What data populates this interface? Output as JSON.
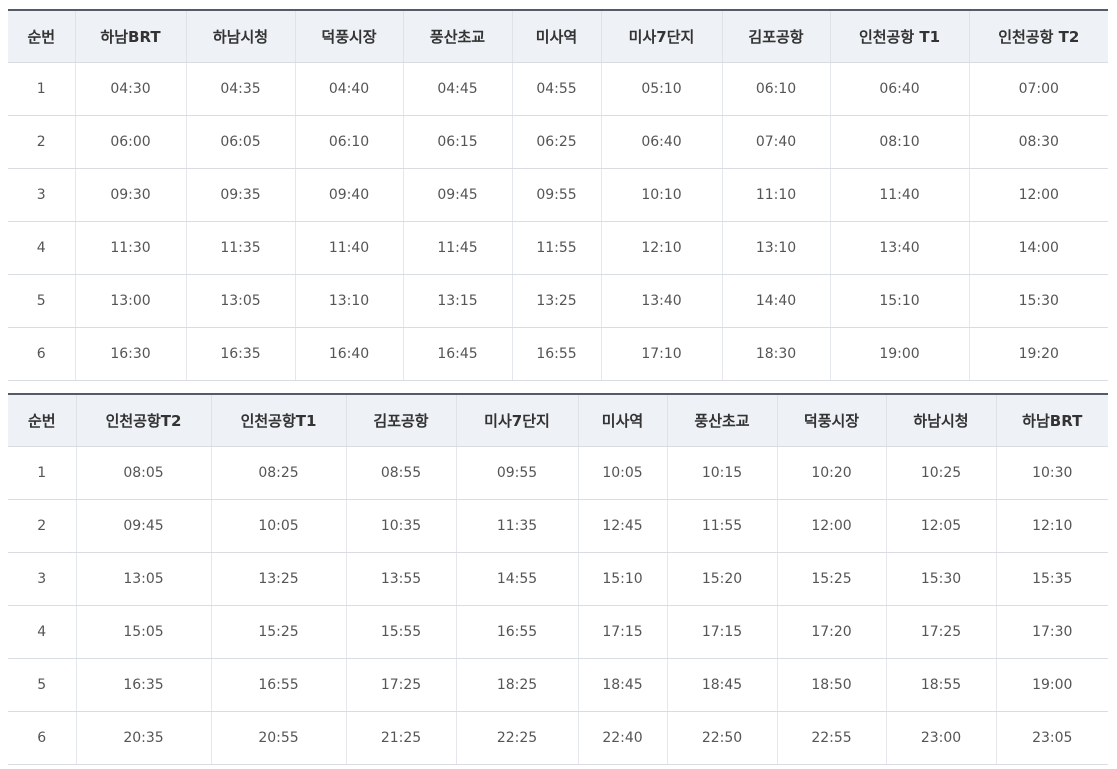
{
  "outbound": {
    "headers": [
      "순번",
      "하남BRT",
      "하남시청",
      "덕풍시장",
      "풍산초교",
      "미사역",
      "미사7단지",
      "김포공항",
      "인천공항 T1",
      "인천공항 T2"
    ],
    "rows": [
      [
        "1",
        "04:30",
        "04:35",
        "04:40",
        "04:45",
        "04:55",
        "05:10",
        "06:10",
        "06:40",
        "07:00"
      ],
      [
        "2",
        "06:00",
        "06:05",
        "06:10",
        "06:15",
        "06:25",
        "06:40",
        "07:40",
        "08:10",
        "08:30"
      ],
      [
        "3",
        "09:30",
        "09:35",
        "09:40",
        "09:45",
        "09:55",
        "10:10",
        "11:10",
        "11:40",
        "12:00"
      ],
      [
        "4",
        "11:30",
        "11:35",
        "11:40",
        "11:45",
        "11:55",
        "12:10",
        "13:10",
        "13:40",
        "14:00"
      ],
      [
        "5",
        "13:00",
        "13:05",
        "13:10",
        "13:15",
        "13:25",
        "13:40",
        "14:40",
        "15:10",
        "15:30"
      ],
      [
        "6",
        "16:30",
        "16:35",
        "16:40",
        "16:45",
        "16:55",
        "17:10",
        "18:30",
        "19:00",
        "19:20"
      ]
    ]
  },
  "inbound": {
    "headers": [
      "순번",
      "인천공항T2",
      "인천공항T1",
      "김포공항",
      "미사7단지",
      "미사역",
      "풍산초교",
      "덕풍시장",
      "하남시청",
      "하남BRT"
    ],
    "rows": [
      [
        "1",
        "08:05",
        "08:25",
        "08:55",
        "09:55",
        "10:05",
        "10:15",
        "10:20",
        "10:25",
        "10:30"
      ],
      [
        "2",
        "09:45",
        "10:05",
        "10:35",
        "11:35",
        "12:45",
        "11:55",
        "12:00",
        "12:05",
        "12:10"
      ],
      [
        "3",
        "13:05",
        "13:25",
        "13:55",
        "14:55",
        "15:10",
        "15:20",
        "15:25",
        "15:30",
        "15:35"
      ],
      [
        "4",
        "15:05",
        "15:25",
        "15:55",
        "16:55",
        "17:15",
        "17:15",
        "17:20",
        "17:25",
        "17:30"
      ],
      [
        "5",
        "16:35",
        "16:55",
        "17:25",
        "18:25",
        "18:45",
        "18:45",
        "18:50",
        "18:55",
        "19:00"
      ],
      [
        "6",
        "20:35",
        "20:55",
        "21:25",
        "22:25",
        "22:40",
        "22:50",
        "22:55",
        "23:00",
        "23:05"
      ]
    ]
  }
}
